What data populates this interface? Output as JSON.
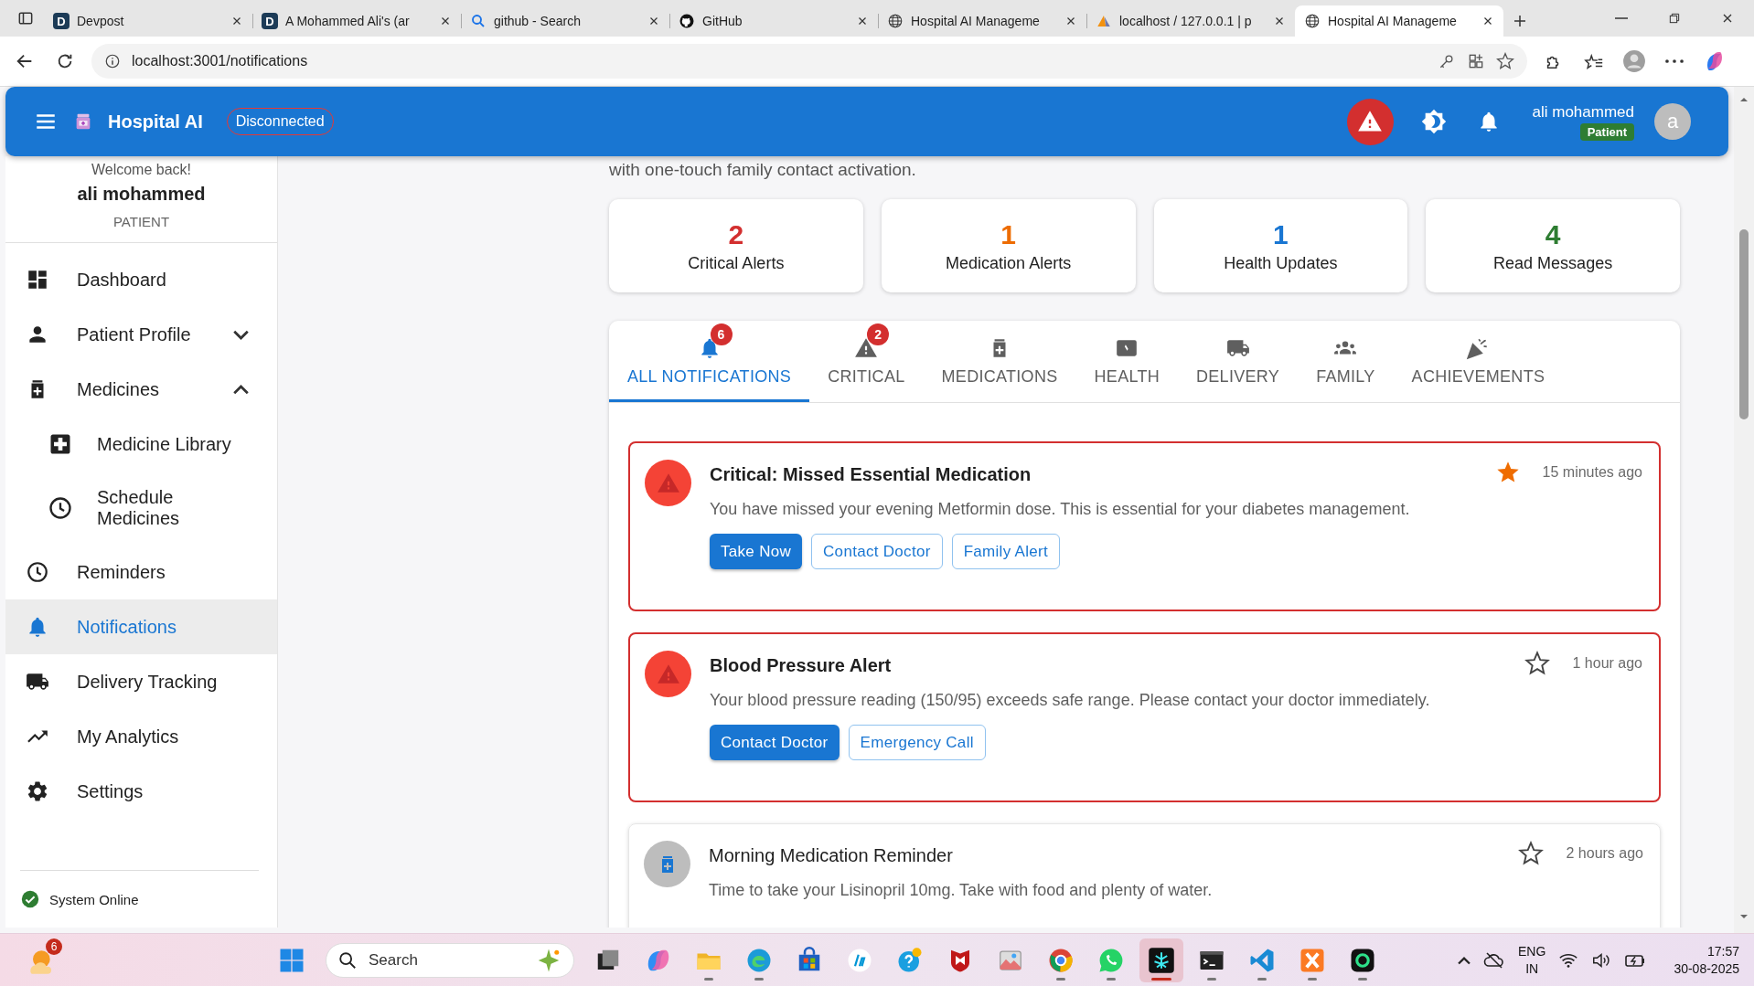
{
  "browser": {
    "tabs": [
      {
        "title": "Devpost",
        "kind": "letter",
        "logo": "D",
        "selected": false
      },
      {
        "title": "A Mohammed Ali's (ar",
        "kind": "letter",
        "logo": "D",
        "selected": false
      },
      {
        "title": "github - Search",
        "kind": "search",
        "selected": false
      },
      {
        "title": "GitHub",
        "kind": "cat",
        "selected": false
      },
      {
        "title": "Hospital AI Manageme",
        "kind": "globe",
        "selected": false
      },
      {
        "title": "localhost / 127.0.0.1 | p",
        "kind": "sail",
        "selected": false
      },
      {
        "title": "Hospital AI Manageme",
        "kind": "globe",
        "selected": true
      }
    ],
    "address": "localhost:3001/notifications"
  },
  "header": {
    "app_name": "Hospital AI",
    "connection": "Disconnected",
    "user_name": "ali mohammed",
    "role": "Patient",
    "avatar": "a"
  },
  "sidebar": {
    "greeting": "Welcome back!",
    "user_name": "ali mohammed",
    "role": "PATIENT",
    "items": [
      {
        "label": "Dashboard",
        "kind": "dashboard",
        "selected": false
      },
      {
        "label": "Patient Profile",
        "kind": "person",
        "selected": false,
        "expanded": false
      },
      {
        "label": "Medicines",
        "kind": "medicine",
        "selected": false,
        "expanded": true,
        "children": [
          {
            "label": "Medicine Library",
            "kind": "plus",
            "selected": false
          },
          {
            "label": "Schedule Medicines",
            "kind": "clock",
            "selected": false
          }
        ]
      },
      {
        "label": "Reminders",
        "kind": "clock",
        "selected": false
      },
      {
        "label": "Notifications",
        "kind": "bell",
        "selected": true
      },
      {
        "label": "Delivery Tracking",
        "kind": "truck",
        "selected": false
      },
      {
        "label": "My Analytics",
        "kind": "trend",
        "selected": false
      },
      {
        "label": "Settings",
        "kind": "gear",
        "selected": false
      }
    ],
    "status": "System Online"
  },
  "intro": "with one-touch family contact activation.",
  "stats": [
    {
      "value": "2",
      "label": "Critical Alerts",
      "color": "#d32f2f"
    },
    {
      "value": "1",
      "label": "Medication Alerts",
      "color": "#ed6c02"
    },
    {
      "value": "1",
      "label": "Health Updates",
      "color": "#1976d2"
    },
    {
      "value": "4",
      "label": "Read Messages",
      "color": "#2e7d32"
    }
  ],
  "tabs": [
    {
      "label": "ALL NOTIFICATIONS",
      "kind": "bell",
      "badge": "6",
      "selected": true
    },
    {
      "label": "CRITICAL",
      "kind": "warning",
      "badge": "2",
      "selected": false
    },
    {
      "label": "MEDICATIONS",
      "kind": "medicine",
      "selected": false
    },
    {
      "label": "HEALTH",
      "kind": "monitor",
      "selected": false
    },
    {
      "label": "DELIVERY",
      "kind": "truck",
      "selected": false
    },
    {
      "label": "FAMILY",
      "kind": "group",
      "selected": false
    },
    {
      "label": "ACHIEVEMENTS",
      "kind": "party",
      "selected": false
    }
  ],
  "notifications": [
    {
      "kind": "critical",
      "title": "Critical: Missed Essential Medication",
      "message": "You have missed your evening Metformin dose. This is essential for your diabetes management.",
      "time": "15 minutes ago",
      "starred": true,
      "read": false,
      "actions": [
        {
          "label": "Take Now",
          "kind": "primary"
        },
        {
          "label": "Contact Doctor",
          "kind": "outlined"
        },
        {
          "label": "Family Alert",
          "kind": "outlined"
        }
      ]
    },
    {
      "kind": "critical",
      "title": "Blood Pressure Alert",
      "message": "Your blood pressure reading (150/95) exceeds safe range. Please contact your doctor immediately.",
      "time": "1 hour ago",
      "starred": false,
      "read": false,
      "actions": [
        {
          "label": "Contact Doctor",
          "kind": "primary"
        },
        {
          "label": "Emergency Call",
          "kind": "outlined"
        }
      ]
    },
    {
      "kind": "reminder",
      "title": "Morning Medication Reminder",
      "message": "Time to take your Lisinopril 10mg. Take with food and plenty of water.",
      "time": "2 hours ago",
      "starred": false,
      "read": true
    }
  ],
  "taskbar": {
    "weather_badge": "6",
    "search": "Search",
    "apps": [
      {
        "kind": "taskview",
        "running": false,
        "selected": false
      },
      {
        "kind": "copilot",
        "running": false,
        "selected": false
      },
      {
        "kind": "folder",
        "running": true,
        "selected": false
      },
      {
        "kind": "edge",
        "running": true,
        "selected": false
      },
      {
        "kind": "store",
        "running": false,
        "selected": false
      },
      {
        "kind": "hp",
        "running": false,
        "selected": false
      },
      {
        "kind": "help",
        "running": false,
        "selected": false
      },
      {
        "kind": "shield",
        "running": false,
        "selected": false
      },
      {
        "kind": "photos",
        "running": false,
        "selected": false
      },
      {
        "kind": "chrome",
        "running": true,
        "selected": false
      },
      {
        "kind": "chat",
        "running": true,
        "selected": false
      },
      {
        "kind": "bug",
        "running": true,
        "selected": true
      },
      {
        "kind": "terminal",
        "running": true,
        "selected": false
      },
      {
        "kind": "code",
        "running": true,
        "selected": false
      },
      {
        "kind": "xampp",
        "running": true,
        "selected": false
      },
      {
        "kind": "ai",
        "running": true,
        "selected": false
      }
    ],
    "language": "ENG",
    "region": "IN",
    "time": "17:57",
    "date": "30-08-2025"
  }
}
